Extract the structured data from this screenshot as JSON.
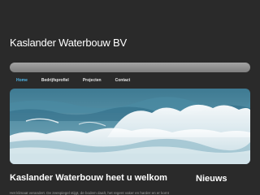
{
  "site": {
    "title": "Kaslander Waterbouw BV"
  },
  "nav": {
    "items": [
      {
        "label": "Home",
        "active": true
      },
      {
        "label": "Bedrijfsprofiel",
        "active": false
      },
      {
        "label": "Projecten",
        "active": false
      },
      {
        "label": "Contact",
        "active": false
      }
    ]
  },
  "hero": {
    "image": "ocean-waves-photo"
  },
  "main": {
    "heading": "Kaslander Waterbouw heet u welkom",
    "text": "Het klimaat verandert. De zeespiegel stijgt, de bodem daalt, het regent vaker en harder en er komt"
  },
  "sidebar": {
    "heading": "Nieuws"
  },
  "colors": {
    "background": "#2a2a2a",
    "nav_active": "#4fb6e8",
    "bar": "#8f8f8f"
  }
}
